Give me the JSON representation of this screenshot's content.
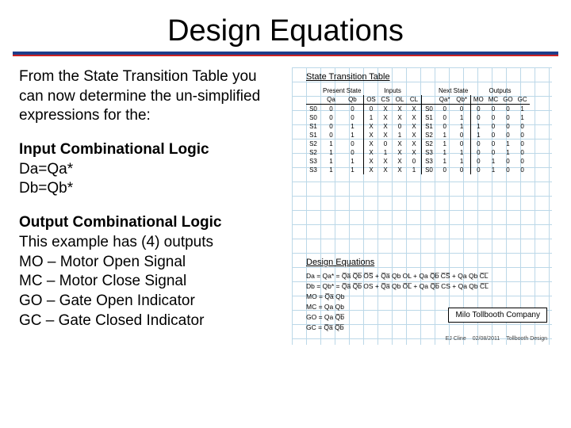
{
  "title": "Design Equations",
  "intro": "From the State Transition Table you can now determine the un-simplified expressions for the:",
  "input_logic": {
    "heading": "Input Combinational Logic",
    "lines": [
      "Da=Qa*",
      "Db=Qb*"
    ]
  },
  "output_logic": {
    "heading": "Output Combinational Logic",
    "lines": [
      "This example has (4) outputs",
      "MO – Motor Open Signal",
      "MC – Motor Close Signal",
      "GO – Gate Open Indicator",
      "GC – Gate Closed Indicator"
    ]
  },
  "stt": {
    "title": "State Transition Table",
    "group_headers": [
      "Present State",
      "Inputs",
      "Next State",
      "Outputs"
    ],
    "col_headers": [
      "",
      "Qa",
      "Qb",
      "OS",
      "CS",
      "OL",
      "CL",
      "",
      "Qa*",
      "Qb*",
      "MO",
      "MC",
      "GO",
      "GC"
    ],
    "rows": [
      [
        "S0",
        "0",
        "0",
        "0",
        "X",
        "X",
        "X",
        "S0",
        "0",
        "0",
        "0",
        "0",
        "0",
        "1"
      ],
      [
        "S0",
        "0",
        "0",
        "1",
        "X",
        "X",
        "X",
        "S1",
        "0",
        "1",
        "0",
        "0",
        "0",
        "1"
      ],
      [
        "S1",
        "0",
        "1",
        "X",
        "X",
        "0",
        "X",
        "S1",
        "0",
        "1",
        "1",
        "0",
        "0",
        "0"
      ],
      [
        "S1",
        "0",
        "1",
        "X",
        "X",
        "1",
        "X",
        "S2",
        "1",
        "0",
        "1",
        "0",
        "0",
        "0"
      ],
      [
        "S2",
        "1",
        "0",
        "X",
        "0",
        "X",
        "X",
        "S2",
        "1",
        "0",
        "0",
        "0",
        "1",
        "0"
      ],
      [
        "S2",
        "1",
        "0",
        "X",
        "1",
        "X",
        "X",
        "S3",
        "1",
        "1",
        "0",
        "0",
        "1",
        "0"
      ],
      [
        "S3",
        "1",
        "1",
        "X",
        "X",
        "X",
        "0",
        "S3",
        "1",
        "1",
        "0",
        "1",
        "0",
        "0"
      ],
      [
        "S3",
        "1",
        "1",
        "X",
        "X",
        "X",
        "1",
        "S0",
        "0",
        "0",
        "0",
        "1",
        "0",
        "0"
      ]
    ]
  },
  "equations": {
    "title": "Design Equations",
    "lines": [
      "Da = Qa* = Q̅a̅ Q̅b̅ O̅S̅ + Q̅a̅ Qb OL + Qa Q̅b̅ C̅S̅ + Qa Qb C̅L̅",
      "Db = Qb* = Q̅a̅ Q̅b̅ OS + Q̅a̅ Qb O̅L̅ + Qa Q̅b̅ CS + Qa Qb C̅L̅",
      "MO = Q̅a̅ Qb",
      "MC = Qa Qb",
      "GO = Qa Q̅b̅",
      "GC = Q̅a̅ Q̅b̅"
    ]
  },
  "stamp": "Milo Tollbooth Company",
  "footer": {
    "author": "EJ Cline",
    "date": "02/08/2011",
    "label": "Tollbooth Design"
  },
  "chart_data": {
    "type": "table",
    "title": "State Transition Table",
    "columns": [
      "State",
      "Qa",
      "Qb",
      "OS",
      "CS",
      "OL",
      "CL",
      "NextState",
      "Qa*",
      "Qb*",
      "MO",
      "MC",
      "GO",
      "GC"
    ],
    "rows": [
      [
        "S0",
        0,
        0,
        0,
        "X",
        "X",
        "X",
        "S0",
        0,
        0,
        0,
        0,
        0,
        1
      ],
      [
        "S0",
        0,
        0,
        1,
        "X",
        "X",
        "X",
        "S1",
        0,
        1,
        0,
        0,
        0,
        1
      ],
      [
        "S1",
        0,
        1,
        "X",
        "X",
        0,
        "X",
        "S1",
        0,
        1,
        1,
        0,
        0,
        0
      ],
      [
        "S1",
        0,
        1,
        "X",
        "X",
        1,
        "X",
        "S2",
        1,
        0,
        1,
        0,
        0,
        0
      ],
      [
        "S2",
        1,
        0,
        "X",
        0,
        "X",
        "X",
        "S2",
        1,
        0,
        0,
        0,
        1,
        0
      ],
      [
        "S2",
        1,
        0,
        "X",
        1,
        "X",
        "X",
        "S3",
        1,
        1,
        0,
        0,
        1,
        0
      ],
      [
        "S3",
        1,
        1,
        "X",
        "X",
        "X",
        0,
        "S3",
        1,
        1,
        0,
        1,
        0,
        0
      ],
      [
        "S3",
        1,
        1,
        "X",
        "X",
        "X",
        1,
        "S0",
        0,
        0,
        0,
        1,
        0,
        0
      ]
    ]
  }
}
